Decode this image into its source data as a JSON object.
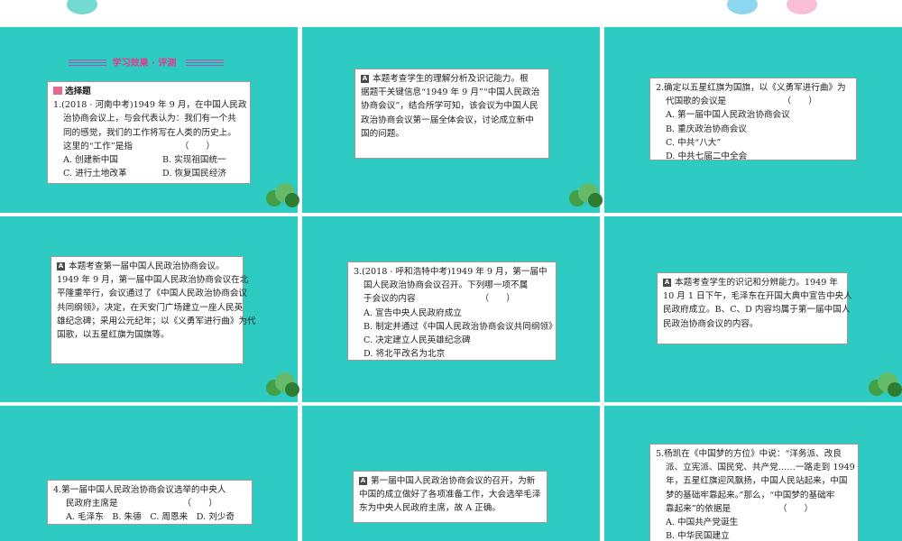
{
  "colors": {
    "slide_bg": "#2dcbc1",
    "accent": "#e33a8e",
    "tree": "#4caf50"
  },
  "slide1": {
    "header": "学习效果 · 评测",
    "section": "选择题",
    "lines": [
      "1.(2018 · 河南中考)1949 年 9 月，在中国人民政",
      "治协商会议上，与会代表认为：我们有一个共",
      "同的感觉，我们的工作将写在人类的历史上。",
      "这里的“工作”是指　　　　　　（　　）"
    ],
    "options": [
      "A. 创建新中国",
      "B. 实现祖国统一",
      "C. 进行土地改革",
      "D. 恢复国民经济"
    ]
  },
  "slide2": {
    "tag": "A",
    "lines": [
      "本题考查学生的理解分析及识记能力。根",
      "据题干关键信息“1949 年 9 月”“中国人民政治",
      "协商会议”，结合所学可知，该会议为中国人民",
      "政治协商会议第一届全体会议，讨论成立新中",
      "国的问题。"
    ]
  },
  "slide3": {
    "lines": [
      "2.确定以五星红旗为国旗，以《义勇军进行曲》为",
      "代国歌的会议是　　　　　　　（　　）"
    ],
    "options": [
      "A. 第一届中国人民政治协商会议",
      "B. 重庆政治协商会议",
      "C. 中共“八大”",
      "D. 中共七届二中全会"
    ]
  },
  "slide4": {
    "tag": "A",
    "lines": [
      "本题考查第一届中国人民政治协商会议。",
      "1949 年 9 月，第一届中国人民政治协商会议在北",
      "平隆重举行，会议通过了《中国人民政治协商会议",
      "共同纲领》，决定，在天安门广场建立一座人民英",
      "雄纪念碑；采用公元纪年；以《义勇军进行曲》为代",
      "国歌，以五星红旗为国旗等。"
    ]
  },
  "slide5": {
    "lines": [
      "3.(2018 · 呼和浩特中考)1949 年 9 月，第一届中",
      "国人民政治协商会议召开。下列哪一项不属",
      "于会议的内容　　　　　　　　（　　）"
    ],
    "options": [
      "A. 宣告中央人民政府成立",
      "B. 制定并通过《中国人民政治协商会议共同纲领》",
      "C. 决定建立人民英雄纪念碑",
      "D. 将北平改名为北京"
    ]
  },
  "slide6": {
    "tag": "A",
    "lines": [
      "本题考查学生的识记和分辨能力。1949 年",
      "10 月 1 日下午，毛泽东在开国大典中宣告中央人",
      "民政府成立。B、C、D 内容均属于第一届中国人",
      "民政治协商会议的内容。"
    ]
  },
  "slide7": {
    "lines": [
      "4.第一届中国人民政治协商会议选举的中央人",
      "民政府主席是　　　　　　　　（　　）"
    ],
    "options_line": "A. 毛泽东　B. 朱德　C. 周恩来　D. 刘少奇"
  },
  "slide8": {
    "tag": "A",
    "lines": [
      "第一届中国人民政治协商会议的召开，为新",
      "中国的成立做好了各项准备工作，大会选举毛泽",
      "东为中央人民政府主席，故 A 正确。"
    ]
  },
  "slide9": {
    "lines": [
      "5.杨凯在《中国梦的方位》中说：“洋务派、改良",
      "派、立宪派、国民党、共产党……一路走到 1949",
      "年，五星红旗迎风飘扬，中国人民站起来，中国",
      "梦的基础牢靠起来。”那么，“中国梦的基础牢",
      "靠起来”的依据是　　　　　　（　　）"
    ],
    "options": [
      "A. 中国共产党诞生",
      "B. 中华民国建立"
    ]
  }
}
